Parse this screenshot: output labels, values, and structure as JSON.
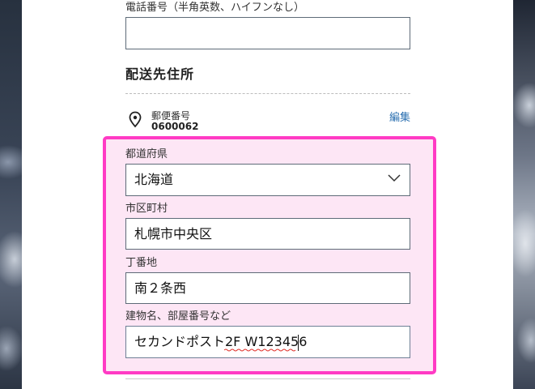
{
  "phone": {
    "label": "電話番号（半角英数、ハイフンなし）",
    "value": ""
  },
  "shipping": {
    "section_title": "配送先住所",
    "postal_label": "郵便番号",
    "postal_value": "0600062",
    "edit_label": "編集"
  },
  "address_form": {
    "prefecture_label": "都道府県",
    "prefecture_value": "北海道",
    "city_label": "市区町村",
    "city_value": "札幌市中央区",
    "street_label": "丁番地",
    "street_value": "南２条西",
    "building_label": "建物名、部屋番号など",
    "building_value": "セカンドポスト2F W123456"
  },
  "colors": {
    "highlight_border": "#ff3bc4",
    "highlight_fill": "#fde6f5",
    "link": "#2a6fb0"
  }
}
